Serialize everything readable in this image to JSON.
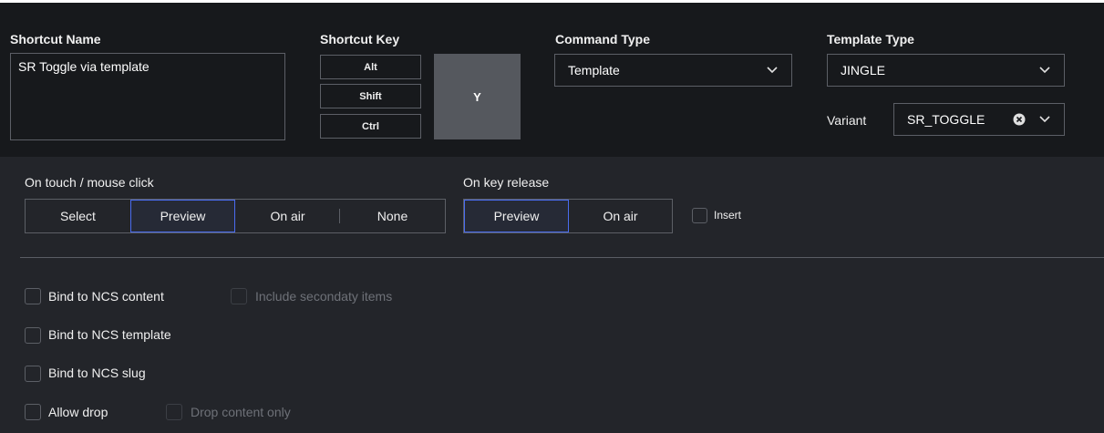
{
  "shortcut_name": {
    "label": "Shortcut Name",
    "value": "SR Toggle via template"
  },
  "shortcut_key": {
    "label": "Shortcut Key",
    "modifiers": [
      "Alt",
      "Shift",
      "Ctrl"
    ],
    "key": "Y"
  },
  "command_type": {
    "label": "Command Type",
    "value": "Template"
  },
  "template_type": {
    "label": "Template Type",
    "value": "JINGLE"
  },
  "variant": {
    "label": "Variant",
    "value": "SR_TOGGLE",
    "clear_icon": "clear-circle-icon"
  },
  "on_click": {
    "label": "On touch / mouse click",
    "options": [
      "Select",
      "Preview",
      "On air",
      "None"
    ],
    "selected": "Preview"
  },
  "on_key_release": {
    "label": "On key release",
    "options": [
      "Preview",
      "On air"
    ],
    "selected": "Preview",
    "insert_label": "Insert"
  },
  "checkboxes": {
    "bind_content": "Bind to NCS content",
    "include_secondary": "Include secondaty items",
    "bind_template": "Bind to NCS template",
    "bind_slug": "Bind to NCS slug",
    "allow_drop": "Allow drop",
    "drop_content_only": "Drop content only"
  },
  "colors": {
    "accent": "#4a6cf0",
    "background": "#1e2024",
    "panel": "#17191c"
  }
}
